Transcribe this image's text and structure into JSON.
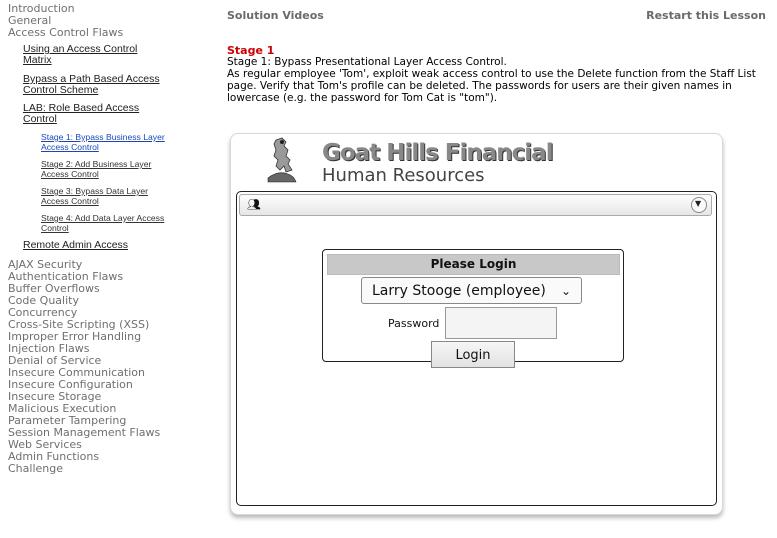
{
  "nav": {
    "top_items": [
      "Introduction",
      "General",
      "Access Control Flaws"
    ],
    "sub_items": [
      "Using an Access Control Matrix",
      "Bypass a Path Based Access Control Scheme",
      "LAB: Role Based Access Control"
    ],
    "stages": [
      "Stage 1: Bypass Business Layer Access Control",
      "Stage 2: Add Business Layer Access Control",
      "Stage 3: Bypass Data Layer Access Control",
      "Stage 4: Add Data Layer Access Control"
    ],
    "remote_admin": "Remote Admin Access",
    "categories": [
      "AJAX Security",
      "Authentication Flaws",
      "Buffer Overflows",
      "Code Quality",
      "Concurrency",
      "Cross-Site Scripting (XSS)",
      "Improper Error Handling",
      "Injection Flaws",
      "Denial of Service",
      "Insecure Communication",
      "Insecure Configuration",
      "Insecure Storage",
      "Malicious Execution",
      "Parameter Tampering",
      "Session Management Flaws",
      "Web Services",
      "Admin Functions",
      "Challenge"
    ]
  },
  "header": {
    "solution_videos": "Solution Videos",
    "restart": "Restart this Lesson"
  },
  "lesson": {
    "stage_heading": "Stage 1",
    "stage_title": "Stage 1: Bypass Presentational Layer Access Control.",
    "description": "As regular employee 'Tom', exploit weak access control to use the Delete function from the Staff List page. Verify that Tom's profile can be deleted. The passwords for users are their given names in lowercase (e.g. the password for Tom Cat is \"tom\")."
  },
  "app": {
    "company": "Goat Hills Financial",
    "department": "Human Resources",
    "login": {
      "title": "Please Login",
      "selected_user": "Larry Stooge (employee)",
      "password_label": "Password",
      "password_value": "",
      "button": "Login"
    }
  },
  "colors": {
    "stage_heading": "#d00000",
    "active_link": "#1a47b8",
    "nav_text": "#6f6f6f"
  }
}
